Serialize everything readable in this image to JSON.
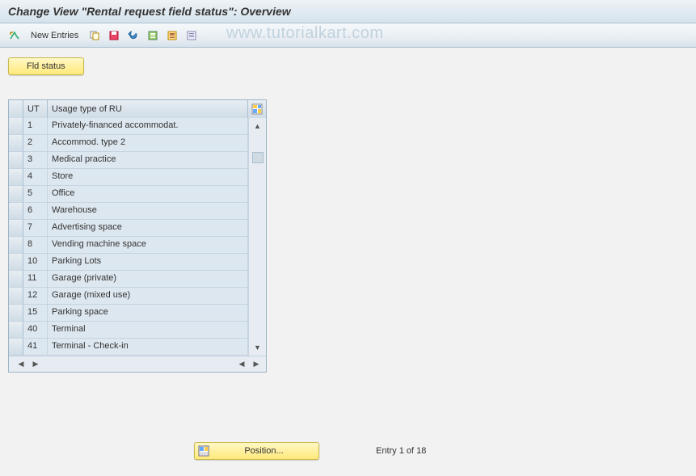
{
  "title": "Change View \"Rental request field status\": Overview",
  "toolbar": {
    "new_entries_label": "New Entries"
  },
  "watermark": "www.tutorialkart.com",
  "fld_status_label": "Fld status",
  "table": {
    "col_ut": "UT",
    "col_usage": "Usage type of RU",
    "rows": [
      {
        "ut": "1",
        "usage": "Privately-financed accommodat."
      },
      {
        "ut": "2",
        "usage": "Accommod. type 2"
      },
      {
        "ut": "3",
        "usage": "Medical practice"
      },
      {
        "ut": "4",
        "usage": "Store"
      },
      {
        "ut": "5",
        "usage": "Office"
      },
      {
        "ut": "6",
        "usage": "Warehouse"
      },
      {
        "ut": "7",
        "usage": "Advertising space"
      },
      {
        "ut": "8",
        "usage": "Vending machine space"
      },
      {
        "ut": "10",
        "usage": "Parking Lots"
      },
      {
        "ut": "11",
        "usage": "Garage (private)"
      },
      {
        "ut": "12",
        "usage": "Garage (mixed use)"
      },
      {
        "ut": "15",
        "usage": "Parking space"
      },
      {
        "ut": "40",
        "usage": "Terminal"
      },
      {
        "ut": "41",
        "usage": "Terminal - Check-in"
      }
    ]
  },
  "position_label": "Position...",
  "entry_text": "Entry 1 of 18"
}
